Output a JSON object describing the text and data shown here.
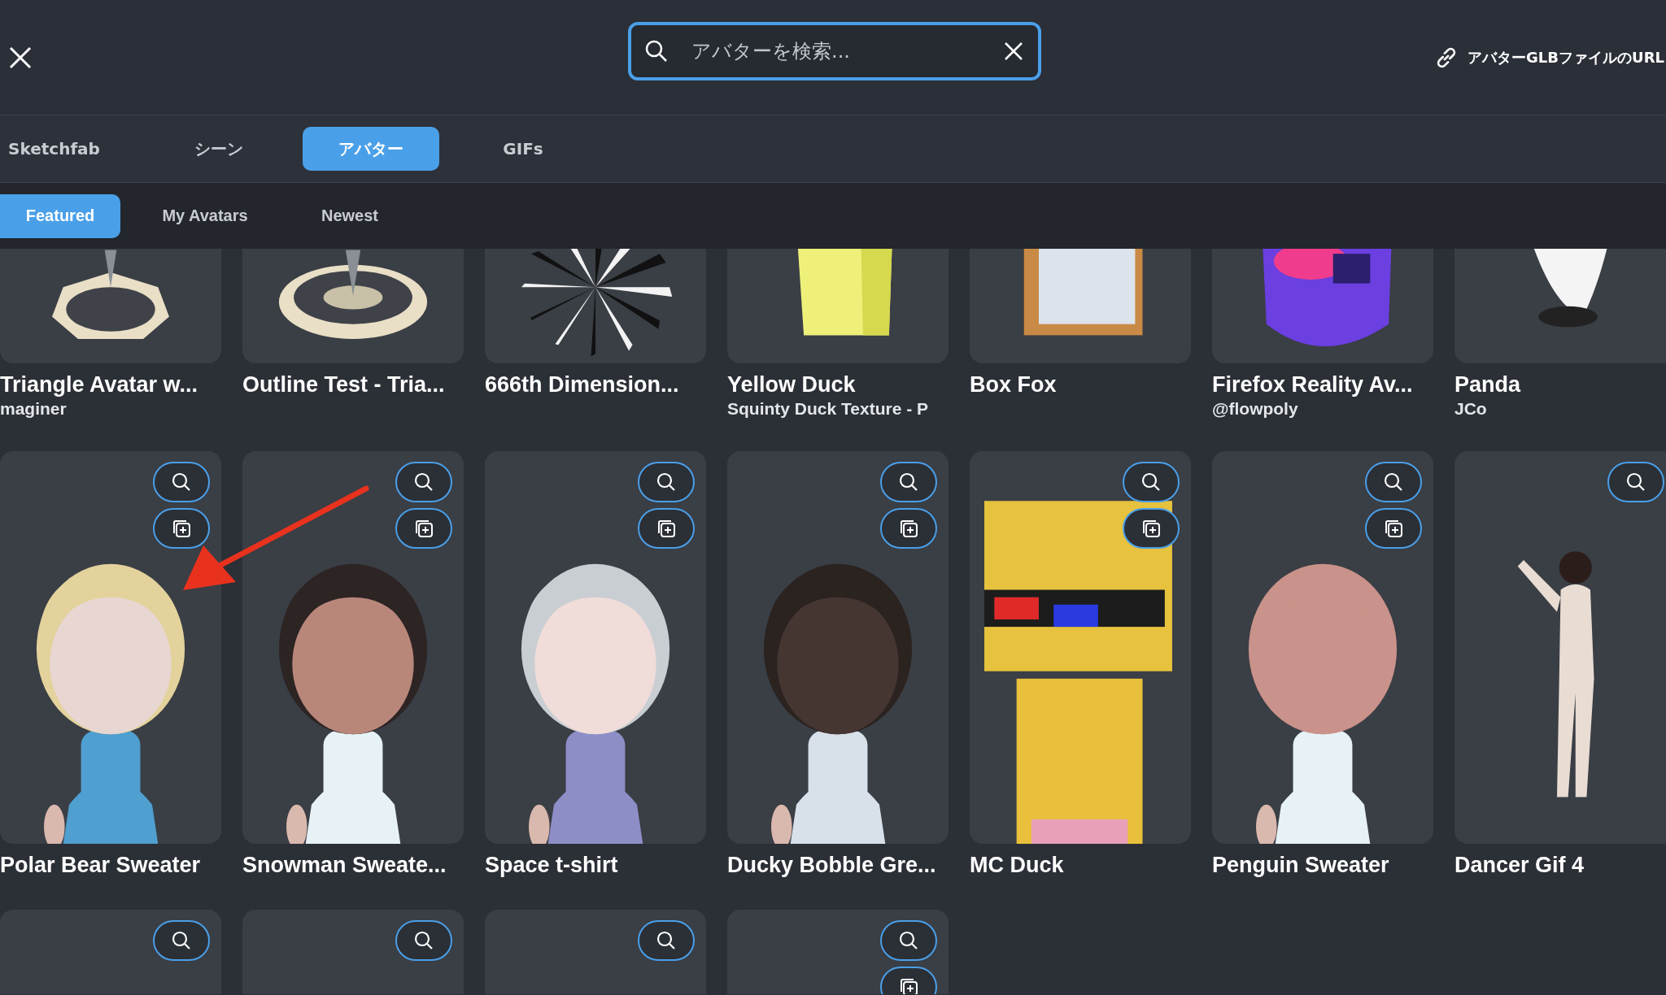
{
  "search": {
    "placeholder": "アバターを検索..."
  },
  "url_link": {
    "label": "アバターGLBファイルのURL"
  },
  "tabs": [
    {
      "label": "Sketchfab",
      "selected": false
    },
    {
      "label": "シーン",
      "selected": false
    },
    {
      "label": "アバター",
      "selected": true
    },
    {
      "label": "GIFs",
      "selected": false
    }
  ],
  "filters": [
    {
      "label": "Featured",
      "selected": true
    },
    {
      "label": "My Avatars",
      "selected": false
    },
    {
      "label": "Newest",
      "selected": false
    }
  ],
  "cards": [
    {
      "title": "Triangle Avatar w...",
      "subtitle": "maginer",
      "addable": false
    },
    {
      "title": "Outline Test - Tria...",
      "addable": false
    },
    {
      "title": "666th Dimension...",
      "addable": false
    },
    {
      "title": "Yellow Duck",
      "subtitle": "Squinty Duck Texture - P",
      "addable": false
    },
    {
      "title": "Box Fox",
      "addable": false
    },
    {
      "title": "Firefox Reality Av...",
      "subtitle": "@flowpoly",
      "addable": false
    },
    {
      "title": "Panda",
      "subtitle": "JCo",
      "addable": false
    },
    {
      "title": "Polar Bear Sweater",
      "addable": true
    },
    {
      "title": "Snowman Sweate...",
      "addable": true
    },
    {
      "title": "Space t-shirt",
      "addable": true
    },
    {
      "title": "Ducky Bobble Gre...",
      "addable": true
    },
    {
      "title": "MC Duck",
      "addable": true
    },
    {
      "title": "Penguin Sweater",
      "addable": true
    },
    {
      "title": "Dancer Gif 4",
      "addable": false
    },
    {
      "addable": false
    },
    {
      "addable": false
    },
    {
      "addable": false
    },
    {
      "addable": true
    }
  ],
  "overlays": [
    {
      "kind": "arrow"
    }
  ]
}
